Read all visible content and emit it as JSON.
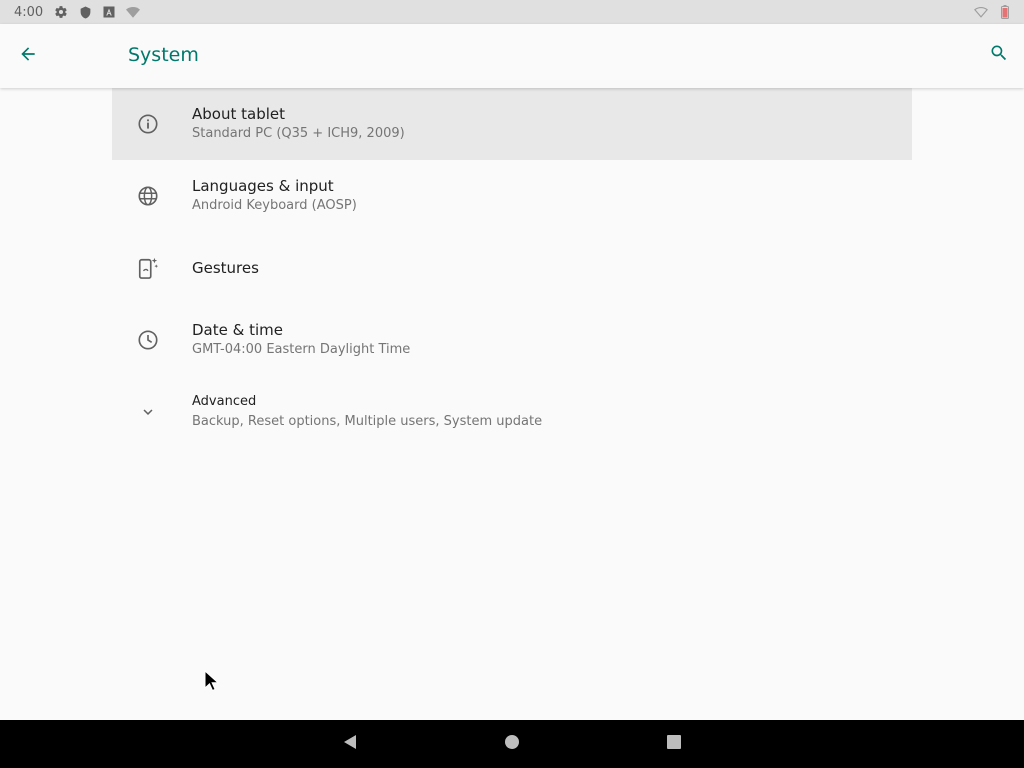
{
  "status_bar": {
    "time": "4:00",
    "left_icons": [
      "settings-icon",
      "shield-icon",
      "a-app-icon",
      "wifi-question-icon"
    ],
    "right_icons": [
      "wifi-icon",
      "battery-icon"
    ]
  },
  "app_bar": {
    "title": "System",
    "back_icon": "arrow-back-icon",
    "search_icon": "search-icon",
    "accent_color": "#00796b"
  },
  "items": [
    {
      "icon": "info-icon",
      "title": "About tablet",
      "subtitle": "Standard PC (Q35 + ICH9, 2009)",
      "selected": true
    },
    {
      "icon": "globe-icon",
      "title": "Languages & input",
      "subtitle": "Android Keyboard (AOSP)"
    },
    {
      "icon": "gestures-icon",
      "title": "Gestures",
      "subtitle": ""
    },
    {
      "icon": "clock-icon",
      "title": "Date & time",
      "subtitle": "GMT-04:00 Eastern Daylight Time"
    },
    {
      "icon": "chevron-down-icon",
      "title": "Advanced",
      "subtitle": "Backup, Reset options, Multiple users, System update"
    }
  ],
  "nav_bar": {
    "buttons": [
      "back-triangle-icon",
      "home-circle-icon",
      "recents-square-icon"
    ]
  }
}
